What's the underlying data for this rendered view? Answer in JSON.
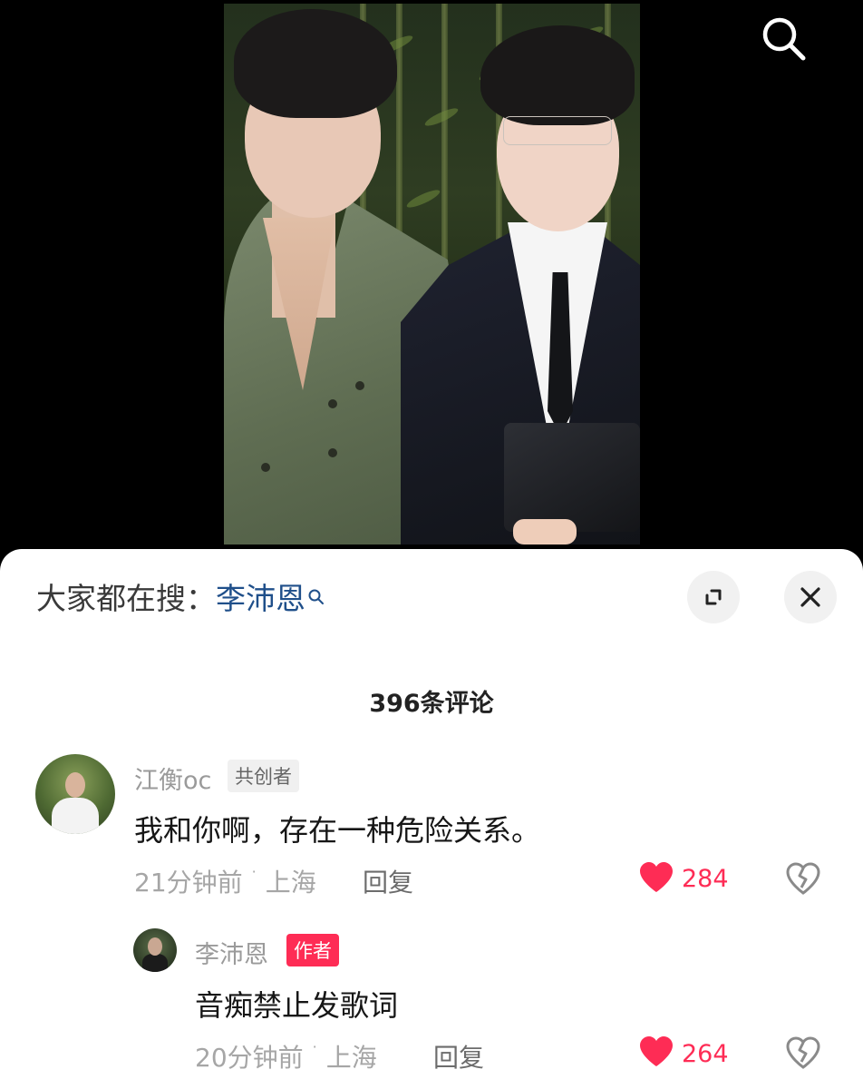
{
  "trending": {
    "prefix": "大家都在搜：",
    "term": "李沛恩"
  },
  "comments_header": {
    "count_label": "396条评论"
  },
  "comments": [
    {
      "username": "江衡oc",
      "badge": "共创者",
      "text": "我和你啊，存在一种危险关系。",
      "time": "21分钟前",
      "location": "上海",
      "reply_label": "回复",
      "likes": "284"
    },
    {
      "username": "李沛恩",
      "badge": "作者",
      "text": "音痴禁止发歌词",
      "time": "20分钟前",
      "location": "上海",
      "reply_label": "回复",
      "likes": "264"
    }
  ],
  "icons": {
    "search": "search-icon",
    "expand": "expand-icon",
    "close": "close-icon",
    "like": "heart-icon",
    "dislike": "broken-heart-icon"
  },
  "colors": {
    "accent": "#fe2c55",
    "trending_term": "#1f4f8a"
  }
}
